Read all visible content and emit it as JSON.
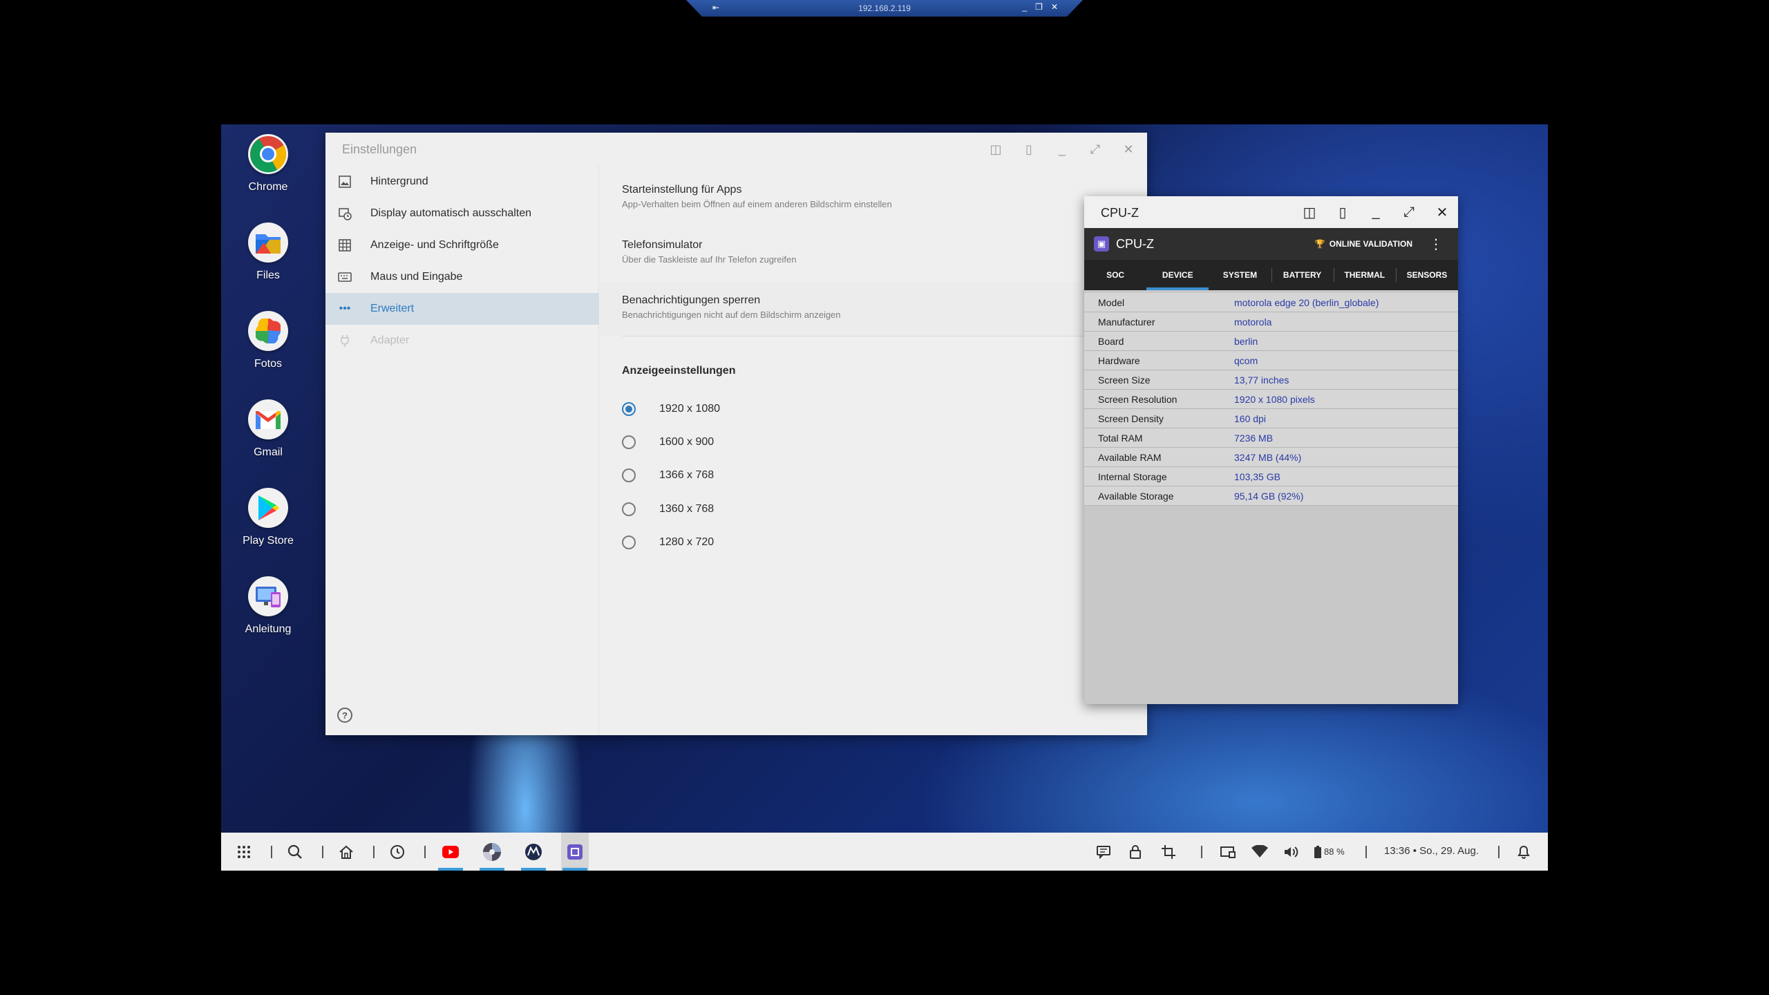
{
  "remote_bar": {
    "address": "192.168.2.119",
    "pin_icon": "pin-icon"
  },
  "desktop_icons": [
    {
      "label": "Chrome"
    },
    {
      "label": "Files"
    },
    {
      "label": "Fotos"
    },
    {
      "label": "Gmail"
    },
    {
      "label": "Play Store"
    },
    {
      "label": "Anleitung"
    }
  ],
  "settings": {
    "title": "Einstellungen",
    "sidebar": [
      {
        "label": "Hintergrund",
        "icon": "wallpaper-icon"
      },
      {
        "label": "Display automatisch ausschalten",
        "icon": "display-timeout-icon"
      },
      {
        "label": "Anzeige- und Schriftgröße",
        "icon": "grid-icon"
      },
      {
        "label": "Maus und Eingabe",
        "icon": "keyboard-icon"
      },
      {
        "label": "Erweitert",
        "icon": "more-icon",
        "active": true
      },
      {
        "label": "Adapter",
        "icon": "plug-icon",
        "disabled": true
      }
    ],
    "options": [
      {
        "title": "Starteinstellung für Apps",
        "subtitle": "App-Verhalten beim Öffnen auf einem anderen Bildschirm einstellen"
      },
      {
        "title": "Telefonsimulator",
        "subtitle": "Über die Taskleiste auf Ihr Telefon zugreifen"
      },
      {
        "title": "Benachrichtigungen sperren",
        "subtitle": "Benachrichtigungen nicht auf dem Bildschirm anzeigen"
      }
    ],
    "section_title": "Anzeigeeinstellungen",
    "resolutions": [
      "1920 x 1080",
      "1600 x 900",
      "1366 x 768",
      "1360 x 768",
      "1280 x 720"
    ],
    "selected_resolution": "1920 x 1080"
  },
  "cpuz": {
    "window_title": "CPU-Z",
    "app_name": "CPU-Z",
    "validation_label": "ONLINE VALIDATION",
    "tabs": [
      "SOC",
      "DEVICE",
      "SYSTEM",
      "BATTERY",
      "THERMAL",
      "SENSORS"
    ],
    "active_tab": "DEVICE",
    "rows": [
      {
        "key": "Model",
        "value": "motorola edge 20 (berlin_globale)"
      },
      {
        "key": "Manufacturer",
        "value": "motorola"
      },
      {
        "key": "Board",
        "value": "berlin"
      },
      {
        "key": "Hardware",
        "value": "qcom"
      },
      {
        "key": "Screen Size",
        "value": "13,77 inches"
      },
      {
        "key": "Screen Resolution",
        "value": "1920 x 1080 pixels"
      },
      {
        "key": "Screen Density",
        "value": "160 dpi"
      },
      {
        "key": "Total RAM",
        "value": "7236 MB"
      },
      {
        "key": "Available RAM",
        "value": "3247 MB  (44%)"
      },
      {
        "key": "Internal Storage",
        "value": "103,35 GB"
      },
      {
        "key": "Available Storage",
        "value": "95,14 GB (92%)"
      }
    ]
  },
  "taskbar": {
    "battery": "88 %",
    "clock": "13:36 • So., 29. Aug."
  }
}
